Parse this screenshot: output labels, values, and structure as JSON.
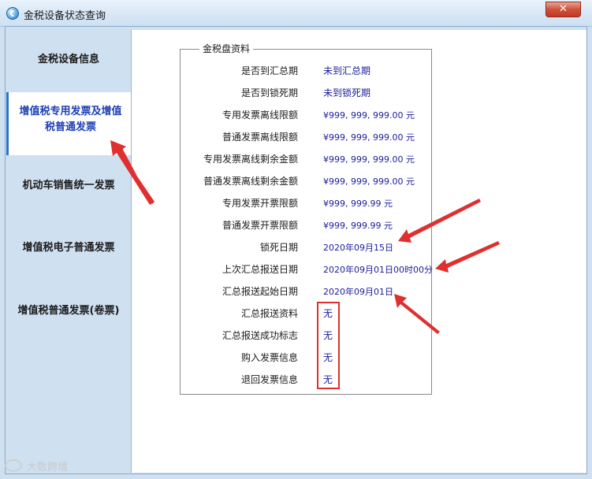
{
  "window": {
    "title": "金税设备状态查询",
    "close_label": "✕"
  },
  "sidebar": {
    "items": [
      {
        "label": "金税设备信息"
      },
      {
        "label": "增值税专用发票及增值税普通发票"
      },
      {
        "label": "机动车销售统一发票"
      },
      {
        "label": "增值税电子普通发票"
      },
      {
        "label": "增值税普通发票(卷票)"
      }
    ]
  },
  "panel": {
    "title": "金税盘资料",
    "rows": [
      {
        "label": "是否到汇总期",
        "value": "未到汇总期"
      },
      {
        "label": "是否到锁死期",
        "value": "未到锁死期"
      },
      {
        "label": "专用发票离线限额",
        "value": "¥999, 999, 999.00 元"
      },
      {
        "label": "普通发票离线限额",
        "value": "¥999, 999, 999.00 元"
      },
      {
        "label": "专用发票离线剩余金额",
        "value": "¥999, 999, 999.00 元"
      },
      {
        "label": "普通发票离线剩余金额",
        "value": "¥999, 999, 999.00 元"
      },
      {
        "label": "专用发票开票限额",
        "value": "¥999, 999.99 元"
      },
      {
        "label": "普通发票开票限额",
        "value": "¥999, 999.99 元"
      },
      {
        "label": "锁死日期",
        "value": "2020年09月15日"
      },
      {
        "label": "上次汇总报送日期",
        "value": "2020年09月01日00时00分"
      },
      {
        "label": "汇总报送起始日期",
        "value": "2020年09月01日"
      },
      {
        "label": "汇总报送资料",
        "value": "无"
      },
      {
        "label": "汇总报送成功标志",
        "value": "无"
      },
      {
        "label": "购入发票信息",
        "value": "无"
      },
      {
        "label": "退回发票信息",
        "value": "无"
      }
    ]
  },
  "watermark": {
    "text": "大数跨境"
  },
  "colors": {
    "annotation_red": "#e02f2f",
    "value_blue": "#1b1b9c",
    "active_nav": "#1f3fb5"
  }
}
